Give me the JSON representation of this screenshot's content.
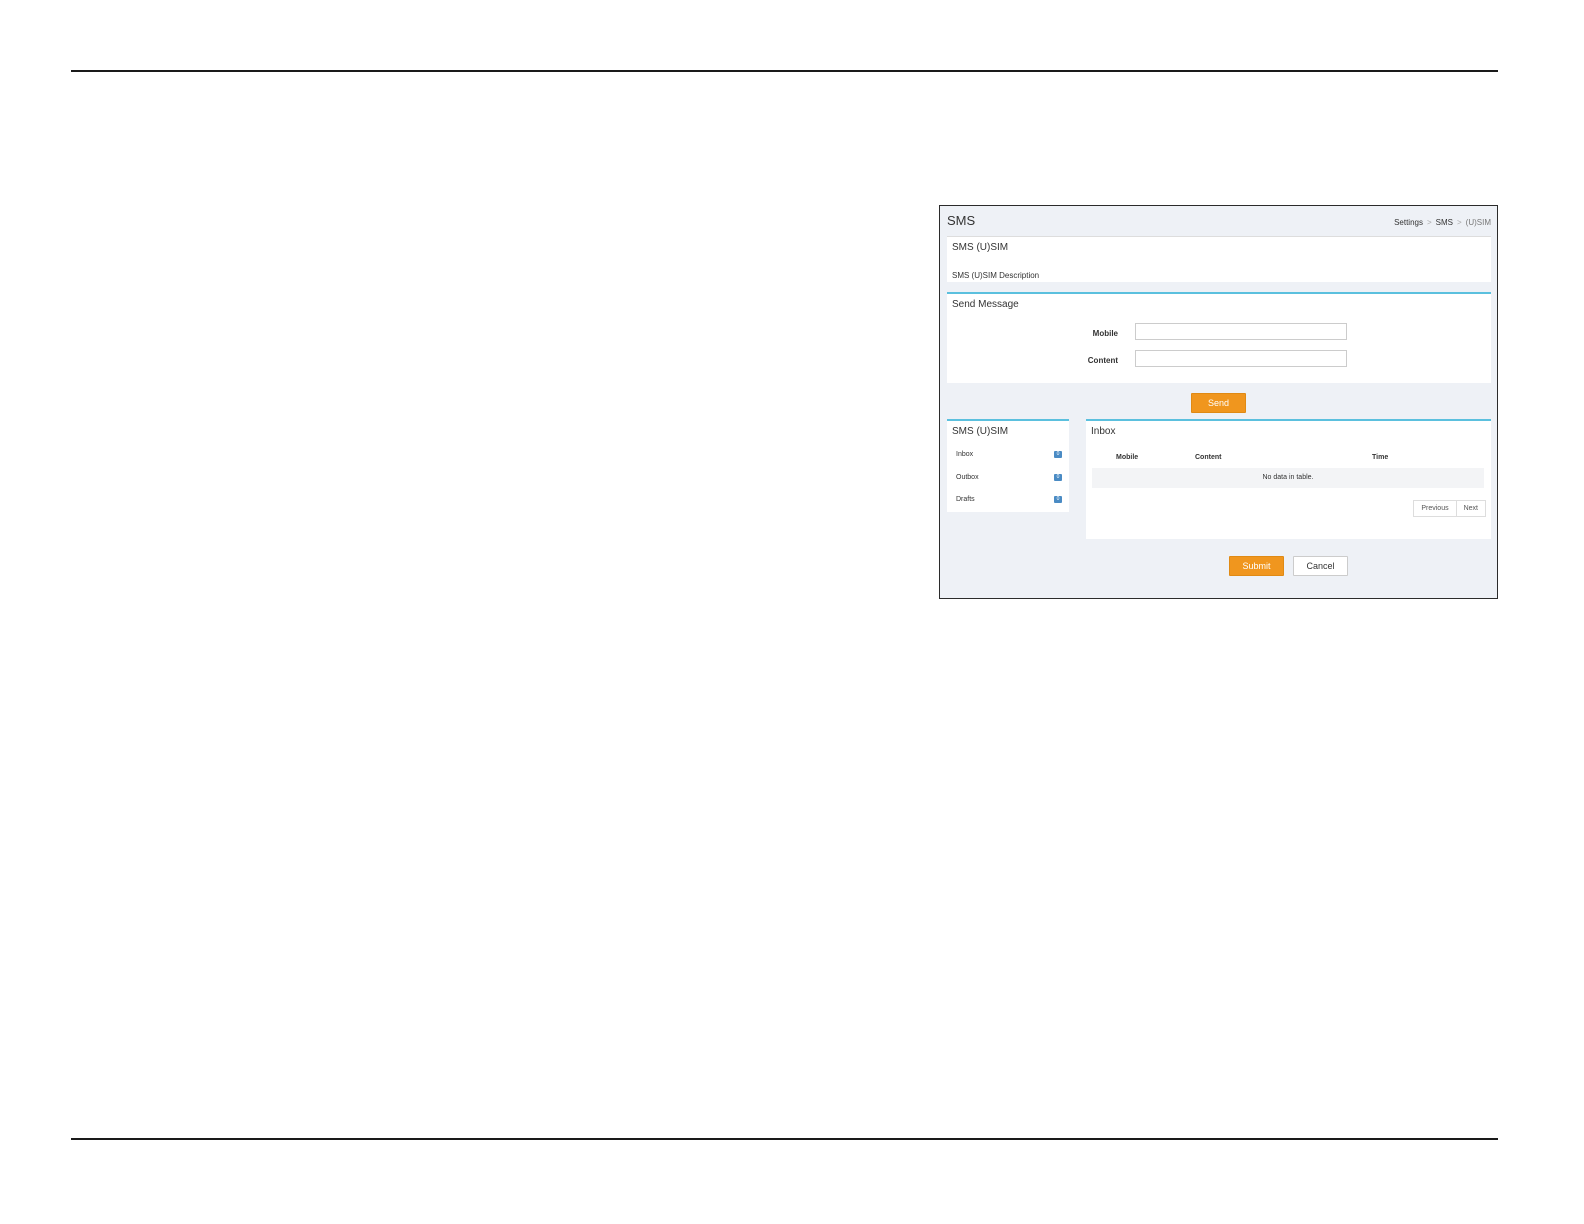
{
  "screen": {
    "title": "SMS",
    "breadcrumb": [
      "Settings",
      "SMS",
      "(U)SIM"
    ],
    "breadcrumb_separator": ">"
  },
  "description_panel": {
    "heading": "SMS (U)SIM",
    "text": "SMS (U)SIM Description"
  },
  "send_message": {
    "heading": "Send Message",
    "mobile_label": "Mobile",
    "mobile_value": "",
    "content_label": "Content",
    "content_value": "",
    "send_label": "Send"
  },
  "folders": {
    "heading": "SMS (U)SIM",
    "items": [
      {
        "label": "Inbox",
        "count": "0"
      },
      {
        "label": "Outbox",
        "count": "0"
      },
      {
        "label": "Drafts",
        "count": "0"
      }
    ]
  },
  "inbox": {
    "heading": "Inbox",
    "columns": [
      "Mobile",
      "Content",
      "Time"
    ],
    "empty_text": "No data in table.",
    "previous_label": "Previous",
    "next_label": "Next"
  },
  "actions": {
    "submit_label": "Submit",
    "cancel_label": "Cancel"
  },
  "colors": {
    "accent_orange": "#f0961e",
    "accent_blue": "#5bc0de",
    "badge_blue": "#4a8bc4",
    "background": "#eef1f6"
  }
}
